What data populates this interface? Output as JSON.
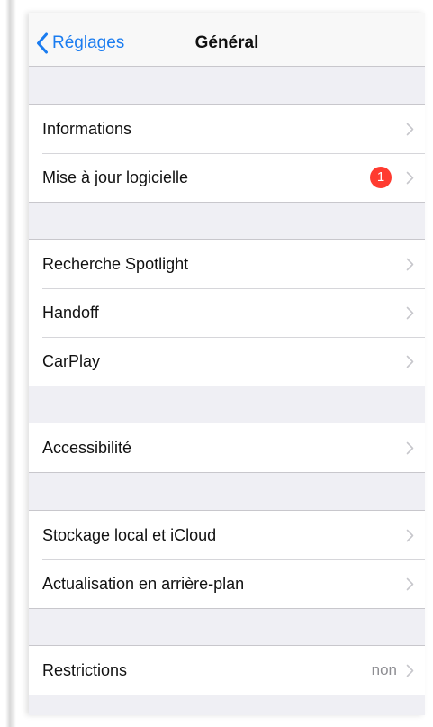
{
  "navbar": {
    "back_label": "Réglages",
    "title": "Général"
  },
  "groups": [
    {
      "rows": [
        {
          "label": "Informations"
        },
        {
          "label": "Mise à jour logicielle",
          "badge": "1"
        }
      ]
    },
    {
      "rows": [
        {
          "label": "Recherche Spotlight"
        },
        {
          "label": "Handoff"
        },
        {
          "label": "CarPlay"
        }
      ]
    },
    {
      "rows": [
        {
          "label": "Accessibilité"
        }
      ]
    },
    {
      "rows": [
        {
          "label": "Stockage local et iCloud"
        },
        {
          "label": "Actualisation en arrière-plan"
        }
      ]
    },
    {
      "rows": [
        {
          "label": "Restrictions",
          "value": "non"
        }
      ]
    }
  ],
  "colors": {
    "accent": "#1a7cf0",
    "badge": "#ff3b30",
    "background": "#efeff4"
  }
}
